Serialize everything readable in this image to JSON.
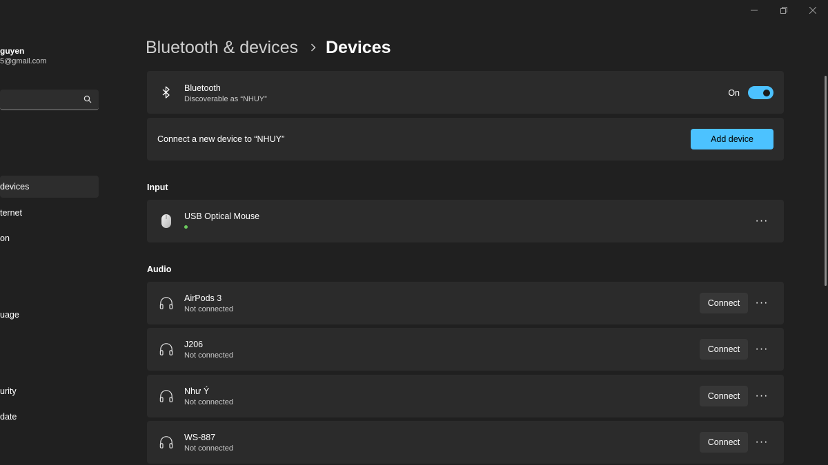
{
  "window": {
    "minimize_icon": "minimize-icon",
    "restore_icon": "restore-icon",
    "close_icon": "close-icon"
  },
  "profile": {
    "name": "guyen",
    "email": "5@gmail.com"
  },
  "search": {
    "value": "",
    "placeholder": "",
    "icon": "search-icon"
  },
  "sidebar": {
    "items": [
      {
        "label": " devices",
        "active": true
      },
      {
        "label": "ternet"
      },
      {
        "label": "on"
      },
      {
        "label": "uage"
      },
      {
        "label": "urity"
      },
      {
        "label": "date"
      }
    ]
  },
  "breadcrumb": {
    "parent": "Bluetooth & devices",
    "current": "Devices"
  },
  "bluetooth": {
    "title": "Bluetooth",
    "subtitle": "Discoverable as “NHUY”",
    "toggle_label": "On",
    "toggle_on": true,
    "icon": "bluetooth-icon"
  },
  "add_device": {
    "text": "Connect a new device to “NHUY”",
    "button_label": "Add device"
  },
  "input_section": {
    "label": "Input",
    "devices": [
      {
        "name": "USB Optical Mouse",
        "connected": true,
        "icon": "mouse-icon"
      }
    ]
  },
  "audio_section": {
    "label": "Audio",
    "devices": [
      {
        "name": "AirPods 3",
        "status": "Not connected",
        "button_label": "Connect",
        "icon": "headphones-icon"
      },
      {
        "name": "J206",
        "status": "Not connected",
        "button_label": "Connect",
        "icon": "headphones-icon"
      },
      {
        "name": "Như Ý",
        "status": "Not connected",
        "button_label": "Connect",
        "icon": "headphones-icon"
      },
      {
        "name": "WS-887",
        "status": "Not connected",
        "button_label": "Connect",
        "icon": "headphones-icon"
      }
    ]
  },
  "more_label": "···",
  "colors": {
    "background": "#202020",
    "card": "#2b2b2b",
    "accent": "#4cc2ff",
    "status_green": "#6ccb5f"
  }
}
